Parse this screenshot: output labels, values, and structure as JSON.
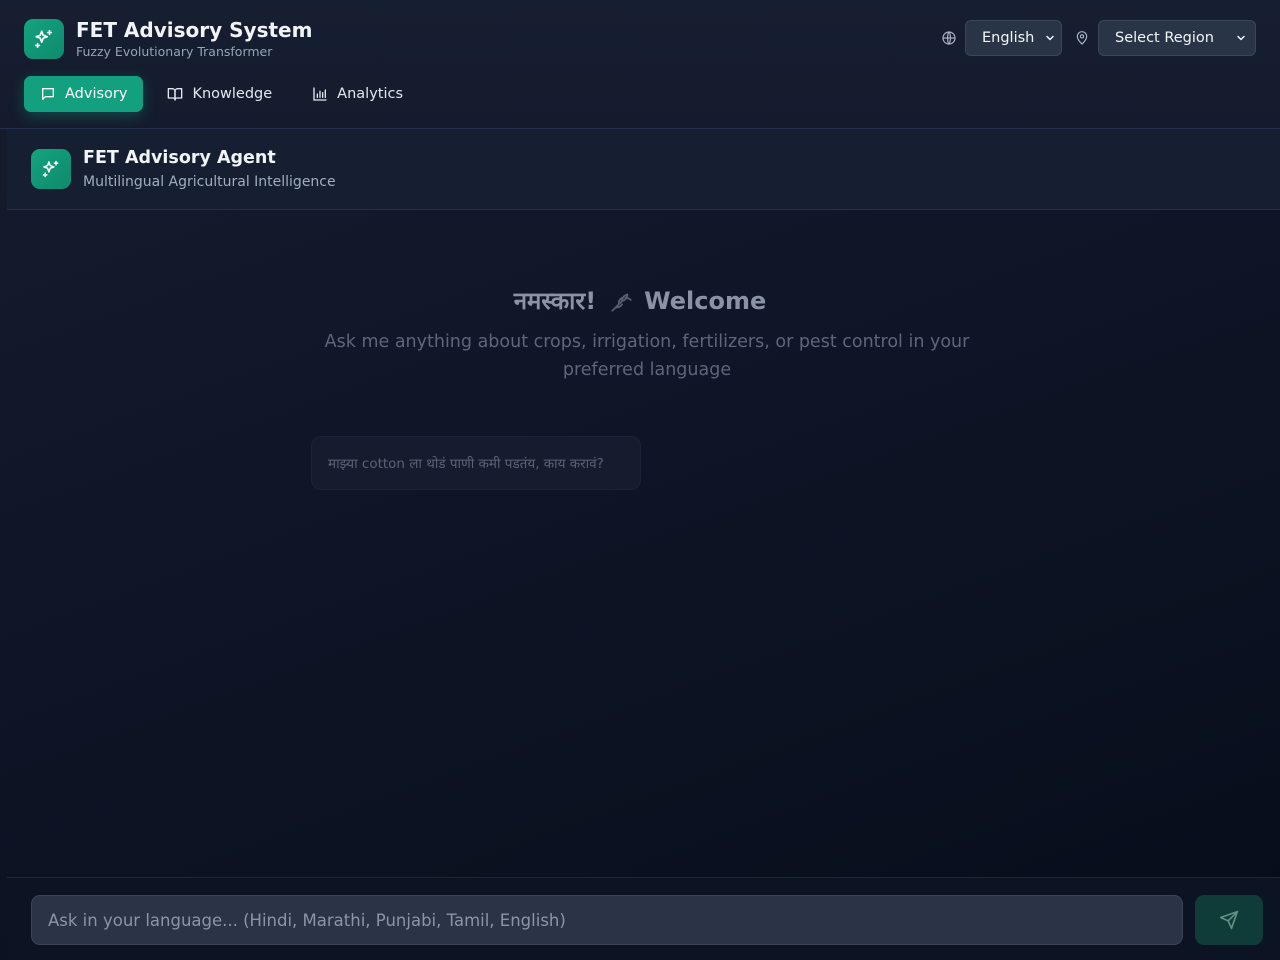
{
  "header": {
    "title": "FET Advisory System",
    "subtitle": "Fuzzy Evolutionary Transformer",
    "logo_icon": "sparkles-icon",
    "language": {
      "icon": "globe-icon",
      "selected": "English"
    },
    "region": {
      "icon": "map-pin-icon",
      "selected": "Select Region"
    }
  },
  "nav": {
    "tabs": [
      {
        "label": "Advisory",
        "icon": "message-square-icon",
        "active": true
      },
      {
        "label": "Knowledge",
        "icon": "book-open-icon",
        "active": false
      },
      {
        "label": "Analytics",
        "icon": "bar-chart-icon",
        "active": false
      }
    ]
  },
  "agent": {
    "title": "FET Advisory Agent",
    "subtitle": "Multilingual Agricultural Intelligence"
  },
  "welcome": {
    "greeting": "नमस्कार!",
    "title": "Welcome",
    "description": "Ask me anything about crops, irrigation, fertilizers, or pest control in your preferred language",
    "suggestions": [
      "माझ्या cotton ला थोडं पाणी कमी पडतंय, काय करावं?"
    ]
  },
  "composer": {
    "placeholder": "Ask in your language... (Hindi, Marathi, Punjabi, Tamil, English)",
    "send_icon": "send-icon"
  },
  "colors": {
    "accent": "#13a07e",
    "background": "#0b1221",
    "header_bg": "#161e31"
  }
}
